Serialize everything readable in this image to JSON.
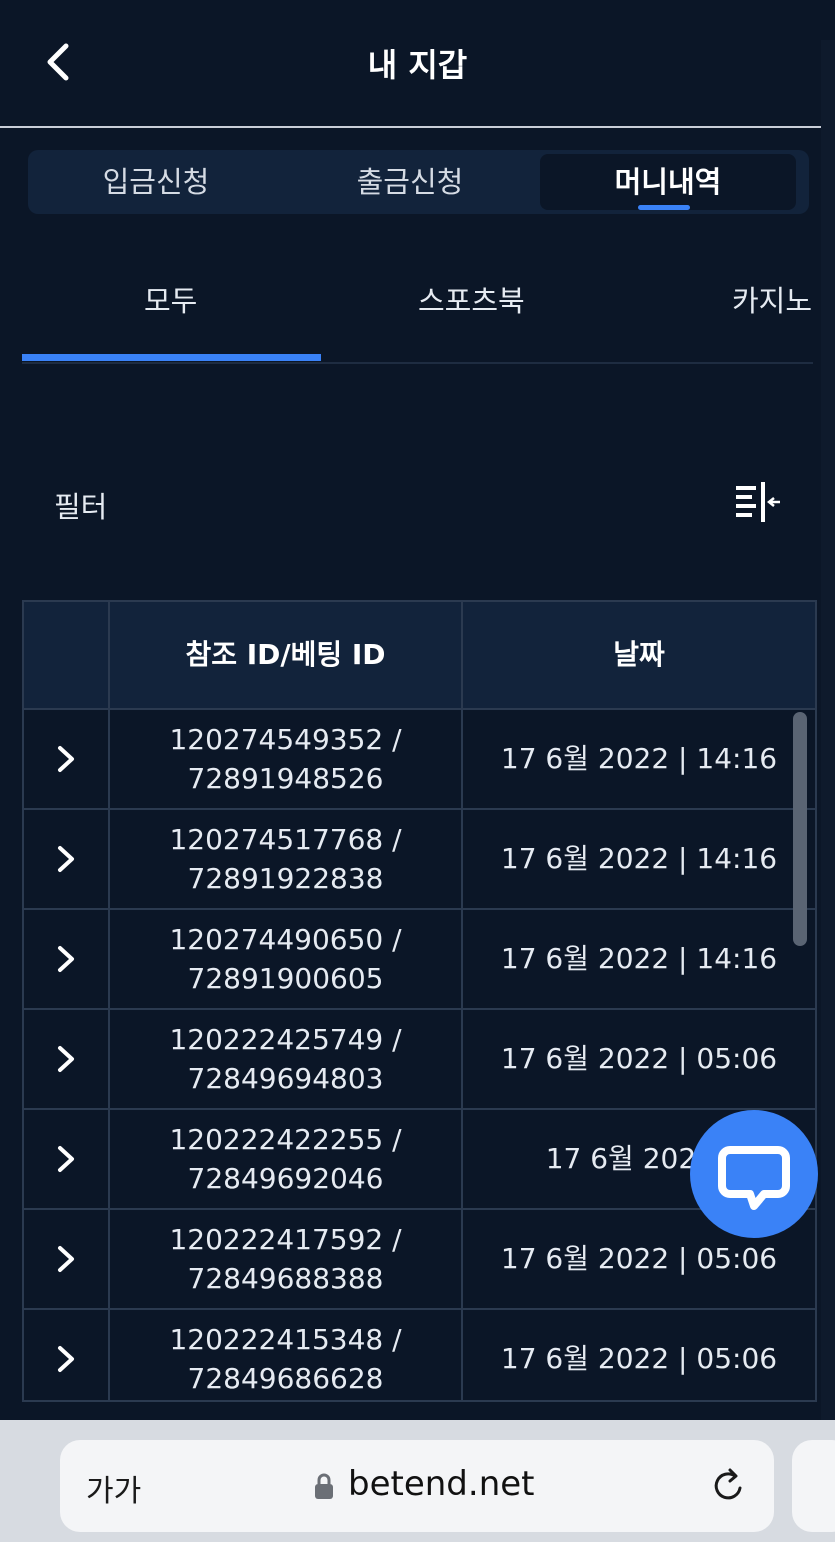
{
  "header": {
    "title": "내 지갑"
  },
  "segments": [
    {
      "label": "입금신청",
      "active": false
    },
    {
      "label": "출금신청",
      "active": false
    },
    {
      "label": "머니내역",
      "active": true
    }
  ],
  "tabs": [
    {
      "label": "모두",
      "active": true
    },
    {
      "label": "스포츠북",
      "active": false
    },
    {
      "label": "카지노",
      "active": false
    }
  ],
  "filter": {
    "label": "필터",
    "icon": "filter-collapse-icon"
  },
  "table": {
    "headers": [
      "",
      "참조 ID/베팅 ID",
      "날짜"
    ],
    "rows": [
      {
        "ref": "120274549352 /",
        "bet": "72891948526",
        "date": "17 6월 2022 | 14:16"
      },
      {
        "ref": "120274517768 /",
        "bet": "72891922838",
        "date": "17 6월 2022 | 14:16"
      },
      {
        "ref": "120274490650 /",
        "bet": "72891900605",
        "date": "17 6월 2022 | 14:16"
      },
      {
        "ref": "120222425749 /",
        "bet": "72849694803",
        "date": "17 6월 2022 | 05:06"
      },
      {
        "ref": "120222422255 /",
        "bet": "72849692046",
        "date": "17 6월 2022 | "
      },
      {
        "ref": "120222417592 /",
        "bet": "72849688388",
        "date": "17 6월 2022 | 05:06"
      },
      {
        "ref": "120222415348 /",
        "bet": "72849686628",
        "date": "17 6월 2022 | 05:06"
      }
    ]
  },
  "chat": {
    "icon": "chat-bubble-icon"
  },
  "browser": {
    "text_size": "가가",
    "url": "betend.net"
  },
  "colors": {
    "background": "#0b1627",
    "accent": "#3a82f7",
    "panel": "#12233b"
  }
}
